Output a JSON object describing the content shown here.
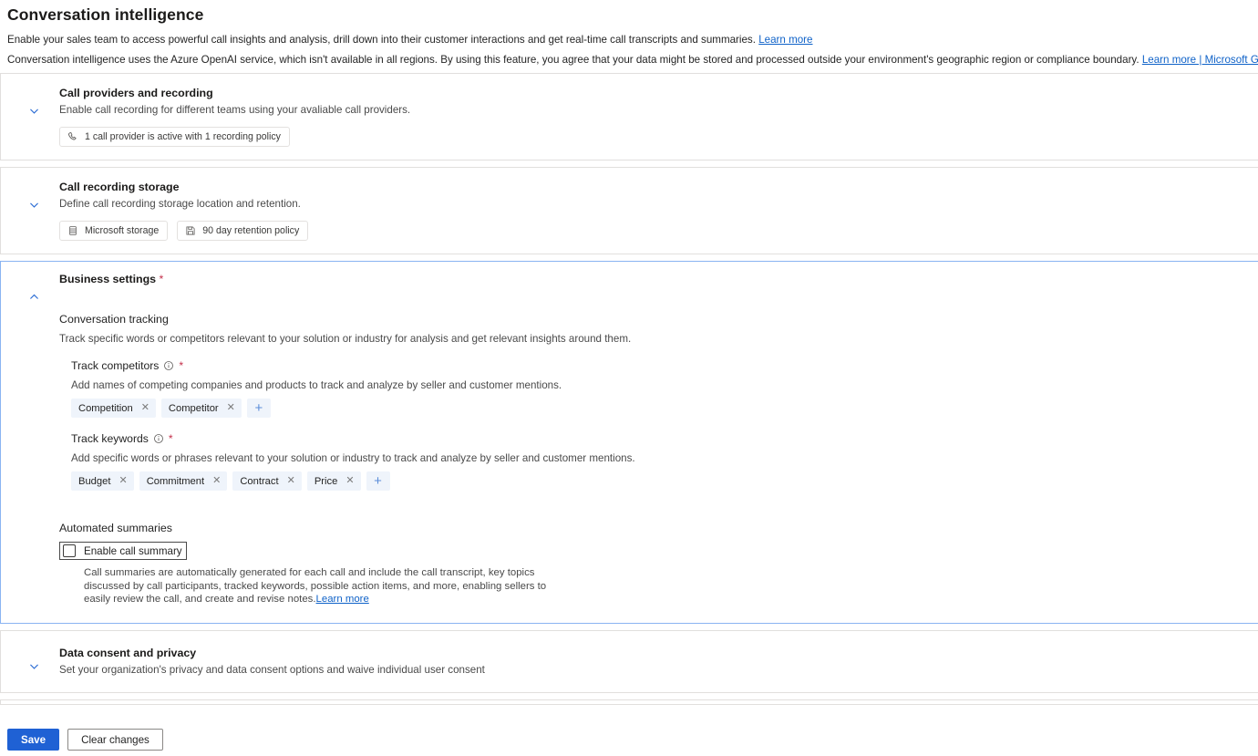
{
  "header": {
    "title": "Conversation intelligence",
    "desc1": "Enable your sales team to access powerful call insights and analysis, drill down into their customer interactions and get real-time call transcripts and summaries.",
    "desc1_link": "Learn more",
    "desc2": "Conversation intelligence uses the Azure OpenAI service, which isn't available in all regions. By using this feature, you agree that your data might be stored and processed outside your environment's geographic region or compliance boundary.",
    "desc2_link": "Learn more | Microsoft Generative AI Services terms"
  },
  "cards": {
    "call_providers": {
      "title": "Call providers and recording",
      "subtitle": "Enable call recording for different teams using your avaliable call providers.",
      "chip_label": "1 call provider is active with 1 recording policy",
      "chip_icon": "phone-icon",
      "chevron_icon": "chevron-down-icon"
    },
    "call_storage": {
      "title": "Call recording storage",
      "subtitle": "Define call recording storage location and retention.",
      "chip1_label": "Microsoft storage",
      "chip1_icon": "database-icon",
      "chip2_label": "90 day retention policy",
      "chip2_icon": "save-icon",
      "chevron_icon": "chevron-down-icon"
    },
    "business_settings": {
      "title": "Business settings",
      "required_mark": "*",
      "chevron_icon": "chevron-up-icon",
      "conversation_tracking": {
        "heading": "Conversation tracking",
        "description": "Track specific words or competitors relevant to your solution or industry for analysis and get relevant insights around them."
      },
      "track_competitors": {
        "label": "Track competitors",
        "info_icon": "info-icon",
        "required_mark": "*",
        "description": "Add names of competing companies and products to track and analyze by seller and customer mentions.",
        "tags": [
          "Competition",
          "Competitor"
        ],
        "add_label": "+"
      },
      "track_keywords": {
        "label": "Track keywords",
        "info_icon": "info-icon",
        "required_mark": "*",
        "description": "Add specific words or phrases relevant to your solution or industry to track and analyze by seller and customer mentions.",
        "tags": [
          "Budget",
          "Commitment",
          "Contract",
          "Price"
        ],
        "add_label": "+"
      },
      "automated_summaries": {
        "heading": "Automated summaries",
        "checkbox_label": "Enable call summary",
        "checkbox_checked": false,
        "description": "Call summaries are automatically generated for each call and include the call transcript, key topics discussed by call participants, tracked keywords, possible action items, and more, enabling sellers to easily review the call, and create and revise notes.",
        "description_link": "Learn more"
      }
    },
    "data_consent": {
      "title": "Data consent and privacy",
      "subtitle": "Set your organization's privacy and data consent options and waive individual user consent",
      "chevron_icon": "chevron-down-icon"
    }
  },
  "footer": {
    "save_label": "Save",
    "clear_label": "Clear changes"
  },
  "colors": {
    "accent": "#1f61d4",
    "chevron": "#2b6cd4",
    "link": "#0f62c8",
    "required": "#c4314b",
    "tag_bg": "#eff4fb",
    "expanded_border": "#8ab4f2"
  }
}
